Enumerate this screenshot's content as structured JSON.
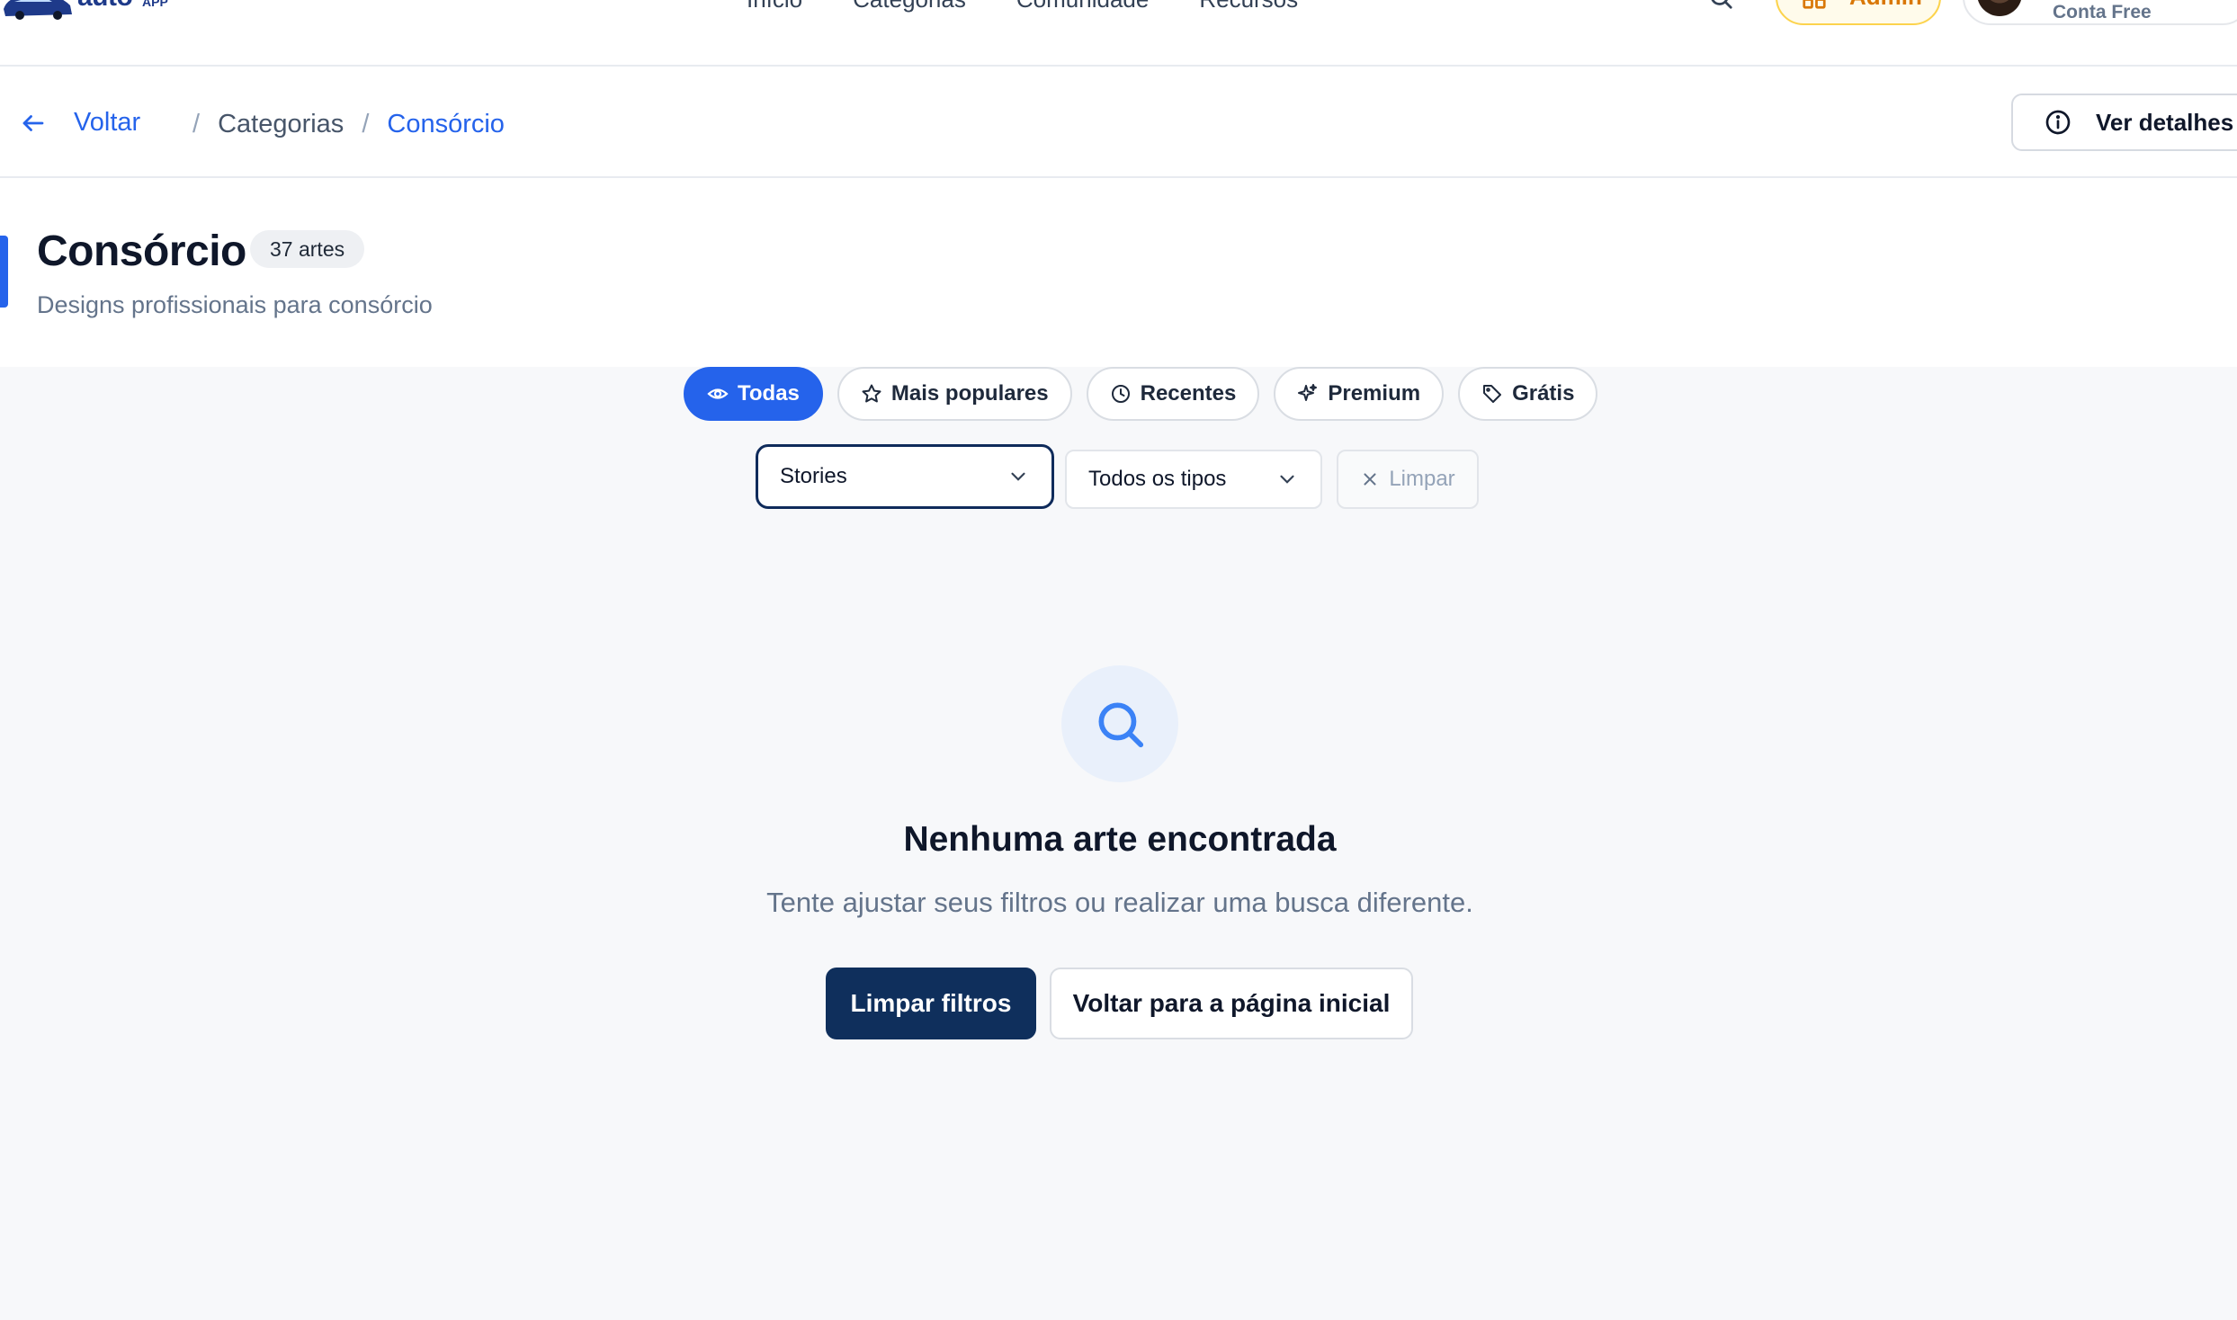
{
  "header": {
    "logo_text": "auto",
    "logo_sup": "APP",
    "nav": [
      "Início",
      "Categorias",
      "Comunidade",
      "Recursos"
    ],
    "admin_label": "Admin",
    "account_plan": "Conta Free"
  },
  "breadcrumb": {
    "back_label": "Voltar",
    "items": [
      "Categorias",
      "Consórcio"
    ],
    "details_label": "Ver detalhes"
  },
  "category": {
    "title": "Consórcio",
    "count": "37 artes",
    "subtitle": "Designs profissionais para consórcio"
  },
  "tabs": [
    {
      "label": "Todas",
      "icon": "eye-icon",
      "active": true
    },
    {
      "label": "Mais populares",
      "icon": "star-icon",
      "active": false
    },
    {
      "label": "Recentes",
      "icon": "clock-icon",
      "active": false
    },
    {
      "label": "Premium",
      "icon": "sparkles-icon",
      "active": false
    },
    {
      "label": "Grátis",
      "icon": "tag-icon",
      "active": false
    }
  ],
  "filters": {
    "format_value": "Stories",
    "type_value": "Todos os tipos",
    "clear_label": "Limpar"
  },
  "empty_state": {
    "title": "Nenhuma arte encontrada",
    "message": "Tente ajustar seus filtros ou realizar uma busca diferente.",
    "clear_button": "Limpar filtros",
    "home_button": "Voltar para a página inicial"
  },
  "colors": {
    "accent": "#2563eb",
    "primary_dark": "#0f2f5c",
    "admin": "#d97706"
  }
}
